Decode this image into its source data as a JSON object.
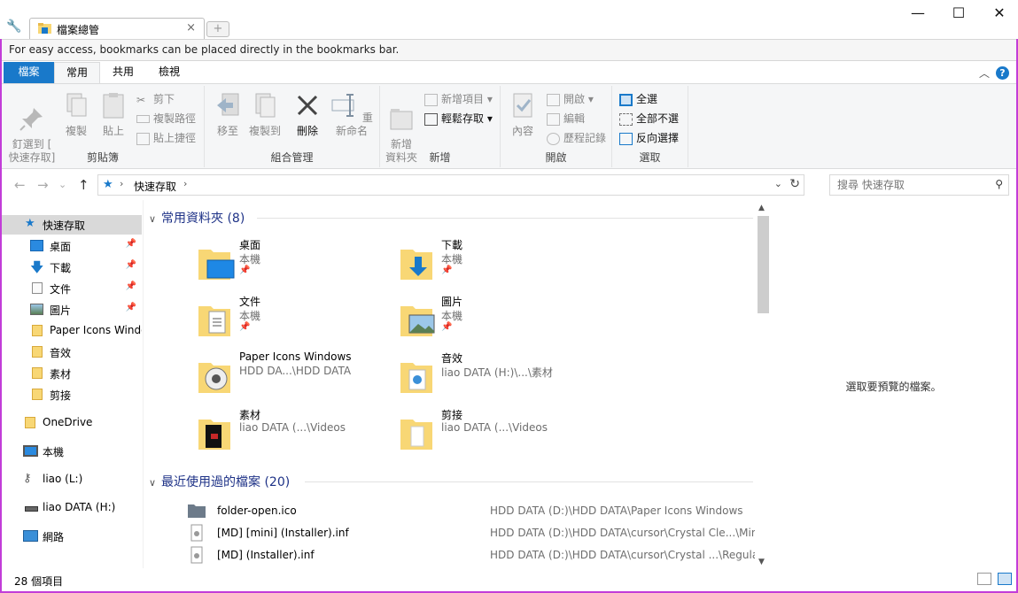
{
  "browser": {
    "tab_title": "檔案總管",
    "tab_close": "×",
    "new_tab": "+",
    "minimize": "—",
    "maximize": "☐",
    "close": "✕",
    "bookmark_hint": "For easy access, bookmarks can be placed directly in the bookmarks bar."
  },
  "ribbon_tabs": [
    "檔案",
    "常用",
    "共用",
    "檢視"
  ],
  "ribbon": {
    "clipboard": {
      "label": "剪貼簿",
      "pin_quick_access": "釘選到 [\n快速存取]",
      "copy": "複製",
      "paste": "貼上",
      "cut": "剪下",
      "copy_path": "複製路徑",
      "paste_shortcut": "貼上捷徑"
    },
    "organize": {
      "label": "組合管理",
      "move_to": "移至",
      "copy_to": "複製到",
      "delete": "刪除",
      "rename": "重新命名"
    },
    "new": {
      "label": "新增",
      "new_folder": "新增\n資料夾",
      "new_item": "新增項目 ▾",
      "easy_access": "輕鬆存取 ▾"
    },
    "open": {
      "label": "開啟",
      "properties": "內容",
      "open": "開啟 ▾",
      "edit": "編輯",
      "history": "歷程記錄"
    },
    "select": {
      "label": "選取",
      "select_all": "全選",
      "select_none": "全部不選",
      "invert": "反向選擇"
    }
  },
  "address": {
    "path": "快速存取",
    "search_placeholder": "搜尋 快速存取"
  },
  "sidebar": {
    "items": [
      {
        "label": "快速存取",
        "pinned": false
      },
      {
        "label": "桌面",
        "pinned": true
      },
      {
        "label": "下載",
        "pinned": true
      },
      {
        "label": "文件",
        "pinned": true
      },
      {
        "label": "圖片",
        "pinned": true
      },
      {
        "label": "Paper Icons Windows",
        "pinned": false
      },
      {
        "label": "音效",
        "pinned": false
      },
      {
        "label": "素材",
        "pinned": false
      },
      {
        "label": "剪接",
        "pinned": false
      },
      {
        "label": "OneDrive",
        "pinned": false
      },
      {
        "label": "本機",
        "pinned": false
      },
      {
        "label": "liao (L:)",
        "pinned": false
      },
      {
        "label": "liao DATA (H:)",
        "pinned": false
      },
      {
        "label": "網路",
        "pinned": false
      }
    ]
  },
  "frequent": {
    "header": "常用資料夾 (8)",
    "items": [
      {
        "name": "桌面",
        "location": "本機",
        "pinned": true
      },
      {
        "name": "下載",
        "location": "本機",
        "pinned": true
      },
      {
        "name": "文件",
        "location": "本機",
        "pinned": true
      },
      {
        "name": "圖片",
        "location": "本機",
        "pinned": true
      },
      {
        "name": "Paper Icons Windows",
        "location": "HDD DA...\\HDD DATA",
        "pinned": false
      },
      {
        "name": "音效",
        "location": "liao DATA (H:)\\...\\素材",
        "pinned": false
      },
      {
        "name": "素材",
        "location": "liao DATA (...\\Videos",
        "pinned": false
      },
      {
        "name": "剪接",
        "location": "liao DATA (...\\Videos",
        "pinned": false
      }
    ]
  },
  "recent": {
    "header": "最近使用過的檔案 (20)",
    "items": [
      {
        "name": "folder-open.ico",
        "path": "HDD DATA (D:)\\HDD DATA\\Paper Icons Windows"
      },
      {
        "name": "[MD] [mini] (Installer).inf",
        "path": "HDD DATA (D:)\\HDD DATA\\cursor\\Crystal Cle...\\Mini"
      },
      {
        "name": "[MD] (Installer).inf",
        "path": "HDD DATA (D:)\\HDD DATA\\cursor\\Crystal ...\\Regular"
      }
    ]
  },
  "preview": {
    "text": "選取要預覽的檔案。"
  },
  "status": {
    "count": "28 個項目"
  },
  "colors": {
    "accent": "#1979ca",
    "frame": "#c23dd8",
    "folder": "#f8d775",
    "header": "#1e3287"
  }
}
